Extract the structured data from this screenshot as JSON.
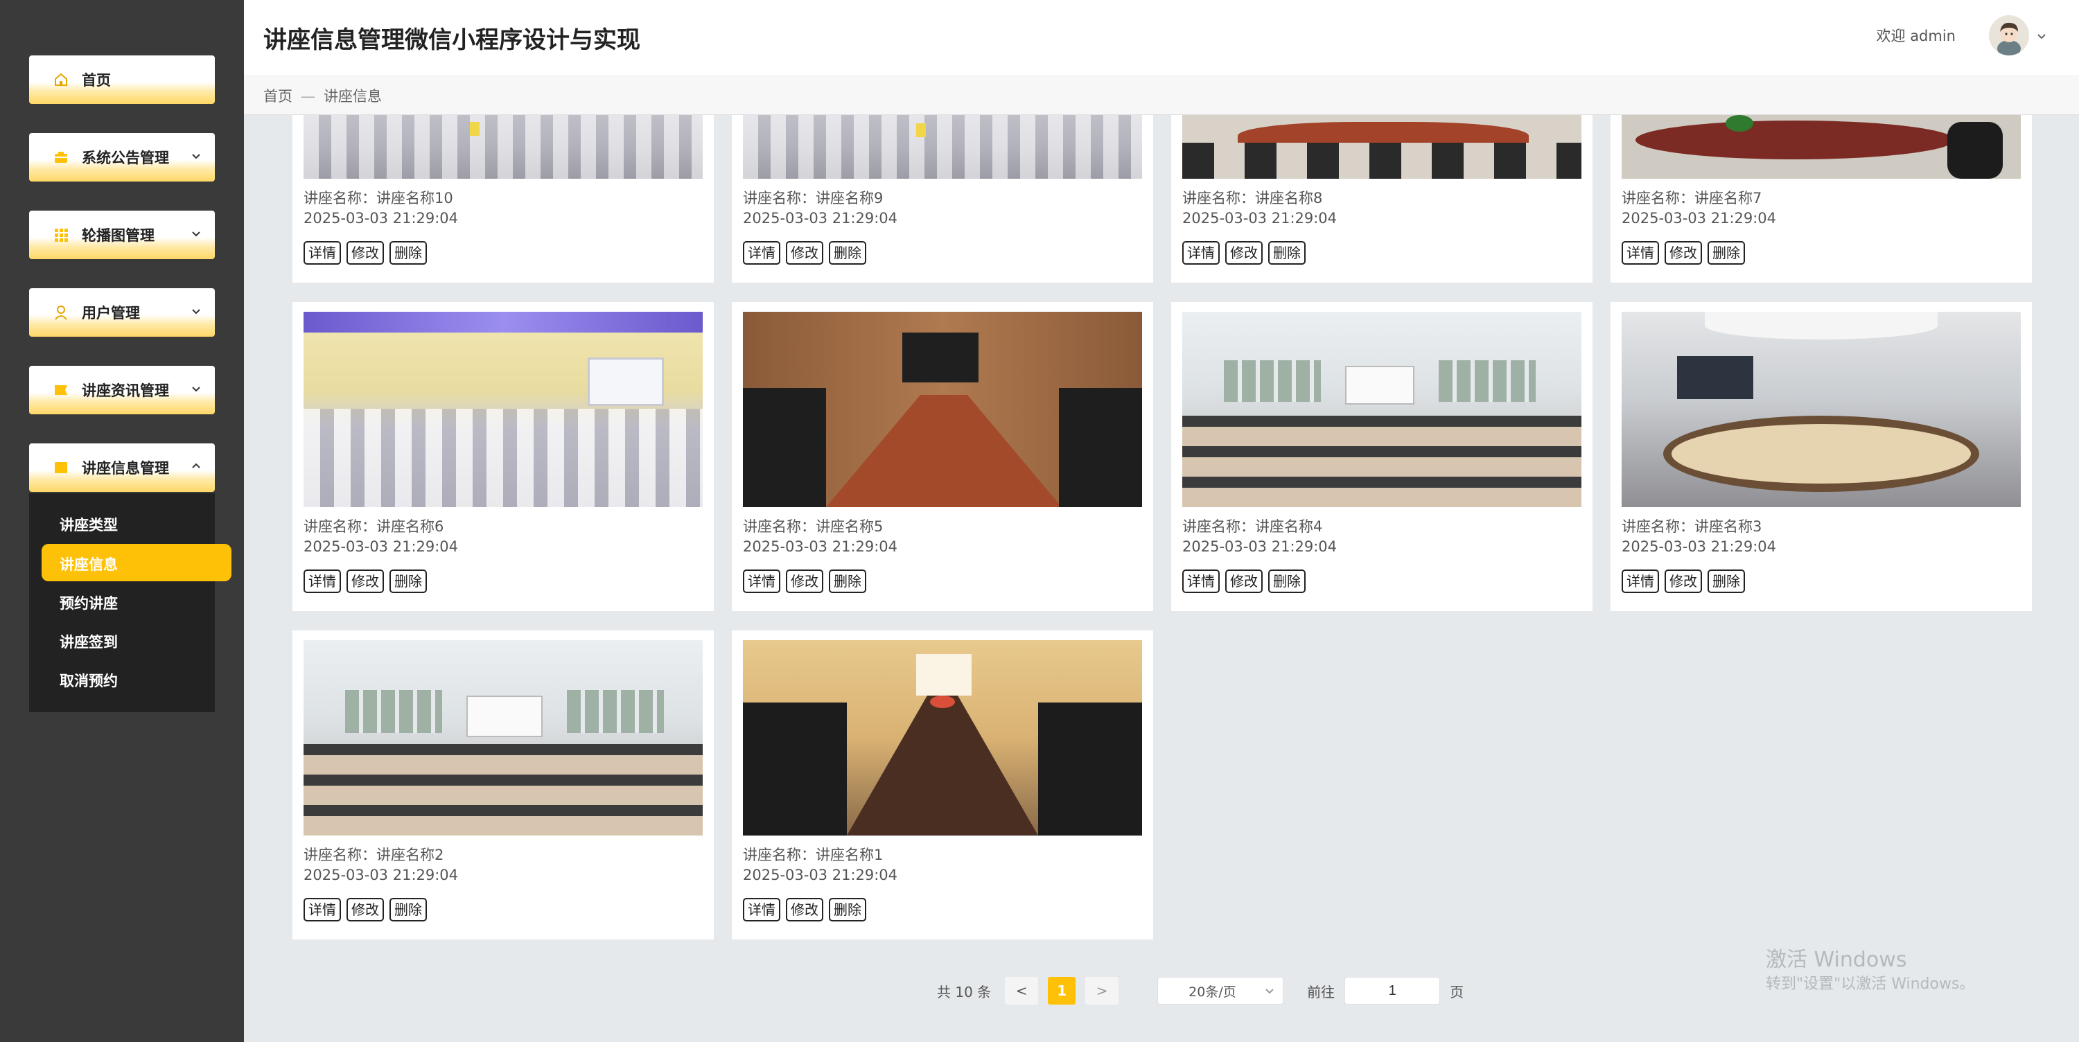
{
  "app": {
    "title": "讲座信息管理微信小程序设计与实现"
  },
  "header": {
    "welcome": "欢迎 admin"
  },
  "breadcrumb": {
    "home": "首页",
    "sep": "—",
    "current": "讲座信息"
  },
  "sidebar": {
    "items": [
      {
        "label": "首页",
        "icon": "home-icon"
      },
      {
        "label": "系统公告管理",
        "icon": "notice-icon"
      },
      {
        "label": "轮播图管理",
        "icon": "grid-icon"
      },
      {
        "label": "用户管理",
        "icon": "user-icon"
      },
      {
        "label": "讲座资讯管理",
        "icon": "news-icon"
      },
      {
        "label": "讲座信息管理",
        "icon": "lecture-icon"
      }
    ],
    "submenu": [
      "讲座类型",
      "讲座信息",
      "预约讲座",
      "讲座签到",
      "取消预约"
    ]
  },
  "cards": [
    {
      "name": "讲座名称：讲座名称10",
      "date": "2025-03-03 21:29:04"
    },
    {
      "name": "讲座名称：讲座名称9",
      "date": "2025-03-03 21:29:04"
    },
    {
      "name": "讲座名称：讲座名称8",
      "date": "2025-03-03 21:29:04"
    },
    {
      "name": "讲座名称：讲座名称7",
      "date": "2025-03-03 21:29:04"
    },
    {
      "name": "讲座名称：讲座名称6",
      "date": "2025-03-03 21:29:04"
    },
    {
      "name": "讲座名称：讲座名称5",
      "date": "2025-03-03 21:29:04"
    },
    {
      "name": "讲座名称：讲座名称4",
      "date": "2025-03-03 21:29:04"
    },
    {
      "name": "讲座名称：讲座名称3",
      "date": "2025-03-03 21:29:04"
    },
    {
      "name": "讲座名称：讲座名称2",
      "date": "2025-03-03 21:29:04"
    },
    {
      "name": "讲座名称：讲座名称1",
      "date": "2025-03-03 21:29:04"
    }
  ],
  "card_buttons": {
    "detail": "详情",
    "edit": "修改",
    "delete": "删除"
  },
  "pagination": {
    "total": "共 10 条",
    "prev": "<",
    "current": "1",
    "next": ">",
    "page_size": "20条/页",
    "goto": "前往",
    "goto_value": "1",
    "suffix": "页"
  },
  "watermark": {
    "line1": "激活 Windows",
    "line2": "转到\"设置\"以激活 Windows。"
  },
  "colors": {
    "accent": "#ffc107",
    "sidebar_bg": "#3a3a3a",
    "submenu_bg": "#222222",
    "page_bg": "#e6e9eb"
  }
}
